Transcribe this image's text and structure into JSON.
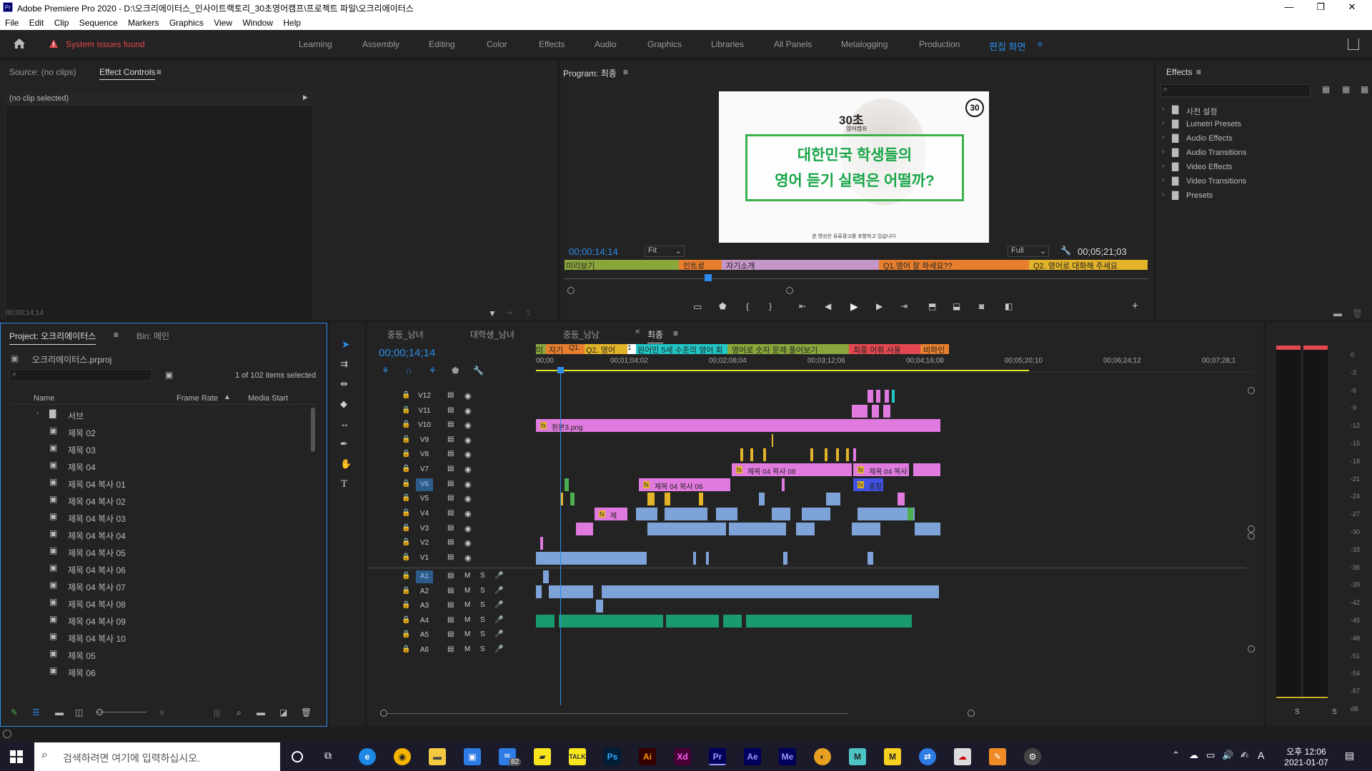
{
  "window": {
    "title": "Adobe Premiere Pro 2020 - D:\\오크리에이터스_인사이트랙토리_30초영어캠프\\프로젝트 파일\\오크리에이터스",
    "logo": "Pr"
  },
  "menu": [
    "File",
    "Edit",
    "Clip",
    "Sequence",
    "Markers",
    "Graphics",
    "View",
    "Window",
    "Help"
  ],
  "workspace": {
    "warning": "System issues found",
    "tabs": [
      "Learning",
      "Assembly",
      "Editing",
      "Color",
      "Effects",
      "Audio",
      "Graphics",
      "Libraries",
      "All Panels",
      "Metalogging",
      "Production"
    ],
    "active": "편집 화면"
  },
  "source": {
    "tab_source": "Source: (no clips)",
    "tab_effect_controls": "Effect Controls",
    "no_clip": "(no clip selected)",
    "timecode": "00;00;14;14"
  },
  "program": {
    "title": "Program: 최종",
    "timecode": "00;00;14;14",
    "fit": "Fit",
    "quality": "Full",
    "duration": "00;05;21;03",
    "frame": {
      "logo": "30초",
      "logo_sub": "영어캠프",
      "badge": "30",
      "line1": "대한민국 학생들의",
      "line2": "영어 듣기 실력은 어떨까?",
      "footer": "본 영상은 유료광고를 포함하고 있습니다"
    },
    "markers": [
      "미리보기",
      "인트로",
      "자기소개",
      "Q1.영어 잘 하세요??",
      "Q2. 영어로 대화해 주세요"
    ]
  },
  "effects": {
    "title": "Effects",
    "items": [
      "사전 설정",
      "Lumetri Presets",
      "Audio Effects",
      "Audio Transitions",
      "Video Effects",
      "Video Transitions",
      "Presets"
    ]
  },
  "project": {
    "tab": "Project: 오크리에이터스",
    "bin": "Bin: 메인",
    "file": "오크리에이터스.prproj",
    "selected": "1 of 102 items selected",
    "cols": [
      "Name",
      "Frame Rate",
      "Media Start"
    ],
    "items": [
      "서브",
      "제목 02",
      "제목 03",
      "제목 04",
      "제목 04 복사 01",
      "제목 04 복사 02",
      "제목 04 복사 03",
      "제목 04 복사 04",
      "제목 04 복사 05",
      "제목 04 복사 06",
      "제목 04 복사 07",
      "제목 04 복사 08",
      "제목 04 복사 09",
      "제목 04 복사 10",
      "제목 05",
      "제목 06"
    ]
  },
  "timeline": {
    "tabs": [
      "중등_남녀",
      "대학생_남녀",
      "중등_남남",
      "최종"
    ],
    "timecode": "00;00;14;14",
    "ruler": [
      "00;00",
      "00;01;04;02",
      "00;02;08;04",
      "00;03;12;06",
      "00;04;16;08",
      "00;05;20;10",
      "00;06;24;12",
      "00;07;28;1"
    ],
    "markers": [
      "미",
      "자기",
      "Q1.",
      "Q2. 영어",
      "1",
      "원어민 5세 수준의 영어 회",
      "영어로 숫자 문제 풀어보기",
      "최종 어휘 사용",
      "비하인"
    ],
    "video_tracks": [
      "V12",
      "V11",
      "V10",
      "V9",
      "V8",
      "V7",
      "V6",
      "V5",
      "V4",
      "V3",
      "V2",
      "V1"
    ],
    "audio_tracks": [
      "A1",
      "A2",
      "A3",
      "A4",
      "A5",
      "A6"
    ],
    "clip_labels": {
      "v10": "원본3.png",
      "v7a": "제목 04 복사 08",
      "v7b": "제목 04 복사",
      "v6a": "제목 04 복사 06",
      "v6b": "종합",
      "v4": "제"
    }
  },
  "meters": {
    "scale": [
      "0",
      "-3",
      "-6",
      "-9",
      "-12",
      "-15",
      "-18",
      "-21",
      "-24",
      "-27",
      "-30",
      "-33",
      "-36",
      "-39",
      "-42",
      "-45",
      "-48",
      "-51",
      "-54",
      "-57",
      "dB"
    ],
    "solo": "S"
  },
  "taskbar": {
    "search": "검색하려면 여기에 입력하십시오.",
    "time": "오후 12:06",
    "date": "2021-01-07",
    "ime": "A",
    "mail_badge": "82"
  }
}
